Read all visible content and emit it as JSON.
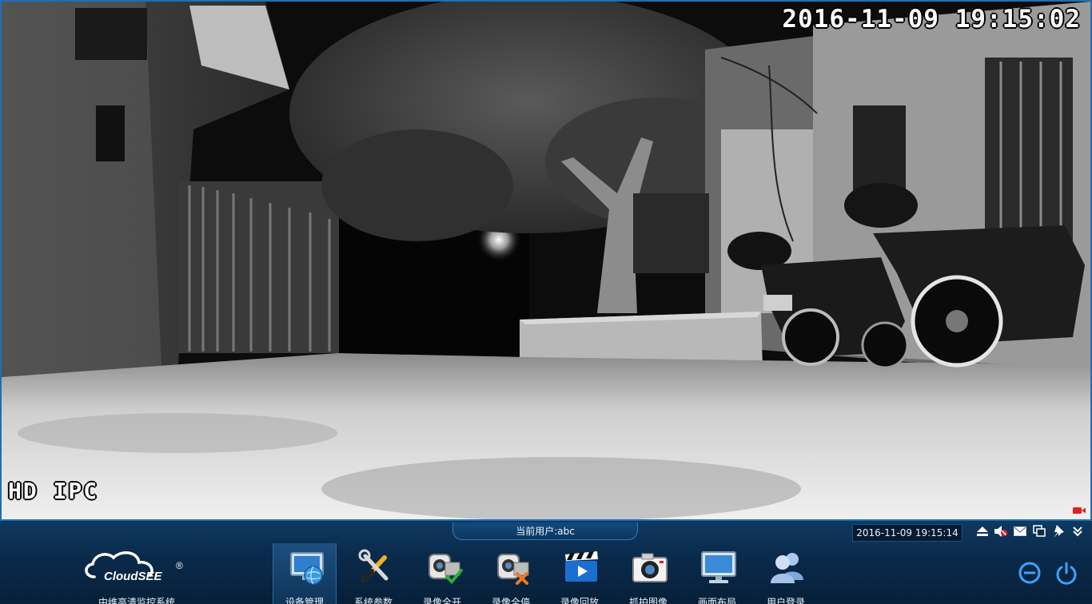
{
  "osd": {
    "datetime": "2016-11-09 19:15:02",
    "label": "HD IPC"
  },
  "header": {
    "current_user": "当前用户:abc",
    "clock": "2016-11-09 19:15:14"
  },
  "brand": {
    "logo_text": "CloudSEE",
    "logo_mark": "®",
    "app_name": "中维高清监控系统"
  },
  "toolbar_icons": [
    "eject-icon",
    "mute-icon",
    "mail-icon",
    "multi-window-icon",
    "pin-icon",
    "collapse-icon"
  ],
  "functions": [
    {
      "id": "device-management",
      "label": "设备管理",
      "icon": "monitor-globe-icon"
    },
    {
      "id": "system-params",
      "label": "系统参数",
      "icon": "tools-icon"
    },
    {
      "id": "record-all-start",
      "label": "录像全开",
      "icon": "camera-check-icon"
    },
    {
      "id": "record-all-stop",
      "label": "录像全停",
      "icon": "camera-stop-icon"
    },
    {
      "id": "playback",
      "label": "录像回放",
      "icon": "clapper-play-icon"
    },
    {
      "id": "snapshot",
      "label": "抓拍图像",
      "icon": "photo-camera-icon"
    },
    {
      "id": "screen-layout",
      "label": "画面布局",
      "icon": "display-icon"
    },
    {
      "id": "user-login",
      "label": "用户登录",
      "icon": "users-icon"
    }
  ],
  "colors": {
    "accent": "#1c6fb8",
    "bar_dark": "#071f38",
    "text": "#e8f2ff",
    "record_red": "#e02020"
  }
}
